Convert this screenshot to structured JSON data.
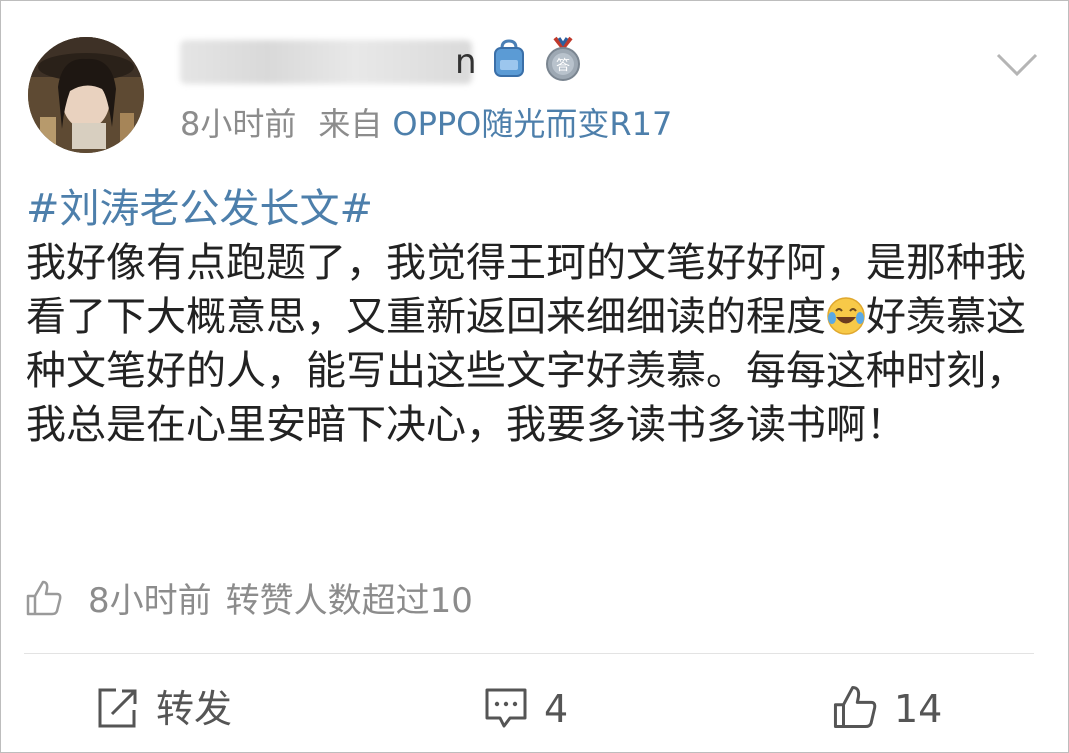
{
  "post": {
    "author": {
      "name_visible_part": "n"
    },
    "meta": {
      "time": "8小时前",
      "from_label": "来自",
      "device": "OPPO随光而变R17"
    },
    "hashtag": "#刘涛老公发长文#",
    "text_part1": "我好像有点跑题了，我觉得王珂的文笔好好阿，是那种我看了下大概意思，又重新返回来细细读的程度",
    "text_part2": "好羡慕这种文笔好的人，能写出这些文字好羡慕。每每这种时刻，我总是在心里安暗下决心，我要多读书多读书啊！",
    "stats": {
      "time": "8小时前",
      "shares_text": "转赞人数超过10"
    },
    "actions": {
      "forward_label": "转发",
      "comment_count": "4",
      "like_count": "14"
    },
    "colors": {
      "link_blue": "#4d7fab",
      "meta_gray": "#8c8c8c",
      "text": "#222222"
    },
    "icons": [
      "avatar",
      "bag-badge-icon",
      "medal-badge-icon",
      "chevron-down-icon",
      "laugh-cry-emoji",
      "thumbs-up-icon",
      "share-icon",
      "comment-icon"
    ]
  }
}
